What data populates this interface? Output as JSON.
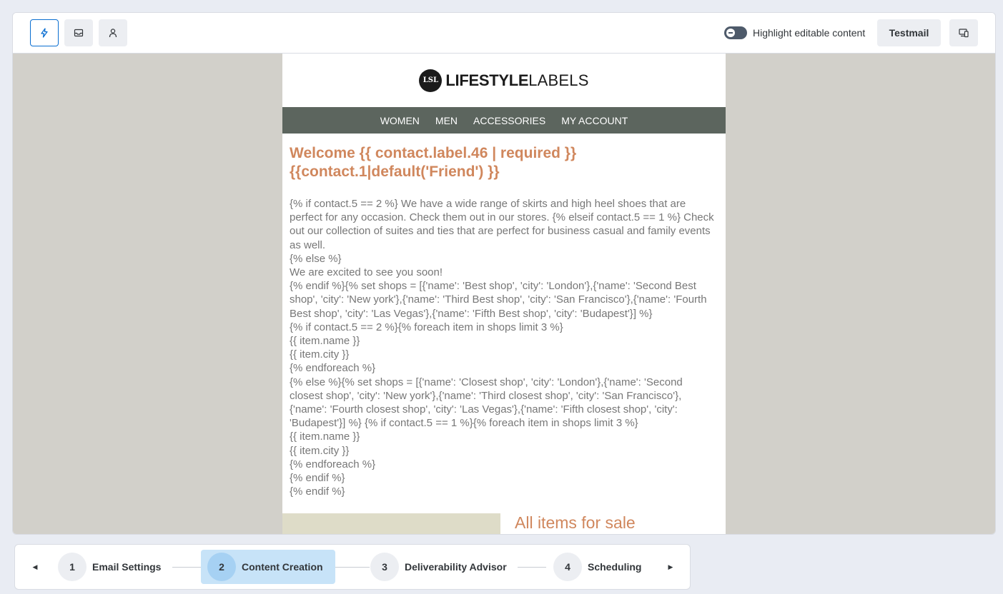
{
  "toolbar": {
    "left_buttons": [
      {
        "name": "lightning-icon",
        "active": true
      },
      {
        "name": "envelope-icon",
        "active": false
      },
      {
        "name": "person-icon",
        "active": false
      }
    ],
    "highlight_label": "Highlight editable content",
    "highlight_toggle": "off",
    "testmail_label": "Testmail",
    "device_icon": "device-preview-icon"
  },
  "email": {
    "logo_strong": "LIFESTYLE",
    "logo_light": "LABELS",
    "logo_mark": "LSL",
    "nav": [
      "WOMEN",
      "MEN",
      "ACCESSORIES",
      "MY ACCOUNT"
    ],
    "welcome": "Welcome {{ contact.label.46 | required }} {{contact.1|default('Friend') }}",
    "template_text": "{% if contact.5 == 2 %} We have a wide range of skirts and high heel shoes that are perfect for any occasion. Check them out in our stores. {% elseif contact.5 == 1 %} Check out our collection of suites and ties that are perfect for business casual and family events as well.\n{% else %}\nWe are excited to see you soon!\n{% endif %}{% set shops = [{'name': 'Best shop', 'city': 'London'},{'name': 'Second Best shop', 'city': 'New york'},{'name': 'Third Best shop', 'city': 'San Francisco'},{'name': 'Fourth Best shop', 'city': 'Las Vegas'},{'name': 'Fifth Best shop', 'city': 'Budapest'}] %}\n{% if contact.5 == 2 %}{% foreach item in shops limit 3 %}\n{{ item.name }}\n{{ item.city }}\n{% endforeach %}\n{% else %}{% set shops = [{'name': 'Closest shop', 'city': 'London'},{'name': 'Second closest shop', 'city': 'New york'},{'name': 'Third closest shop', 'city': 'San Francisco'},{'name': 'Fourth closest shop', 'city': 'Las Vegas'},{'name': 'Fifth closest shop', 'city': 'Budapest'}] %} {% if contact.5 == 1 %}{% foreach item in shops limit 3 %}\n{{ item.name }}\n{{ item.city }}\n{% endforeach %}\n{% endif %}\n{% endif %}",
    "product_title": "All items for sale"
  },
  "stepper": {
    "steps": [
      {
        "num": "1",
        "label": "Email Settings",
        "active": false
      },
      {
        "num": "2",
        "label": "Content Creation",
        "active": true
      },
      {
        "num": "3",
        "label": "Deliverability Advisor",
        "active": false
      },
      {
        "num": "4",
        "label": "Scheduling",
        "active": false
      }
    ]
  },
  "colors": {
    "accent": "#0a6ed1",
    "heading": "#d0875d",
    "nav_bg": "#5c655e",
    "canvas_bg": "#d2d0ca",
    "active_step": "#c7e3f8"
  }
}
